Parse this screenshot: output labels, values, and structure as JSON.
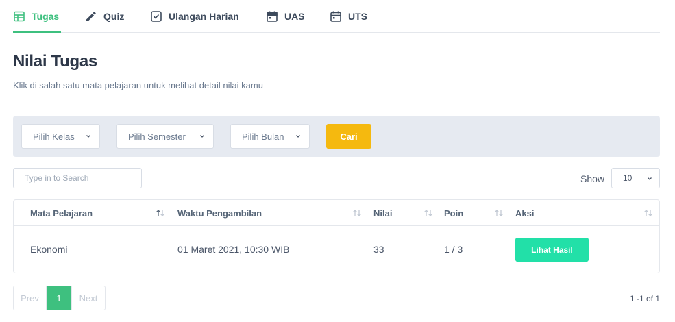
{
  "tabs": [
    {
      "label": "Tugas",
      "icon": "table-icon",
      "active": true
    },
    {
      "label": "Quiz",
      "icon": "pencil-icon",
      "active": false
    },
    {
      "label": "Ulangan Harian",
      "icon": "check-square-icon",
      "active": false
    },
    {
      "label": "UAS",
      "icon": "calendar-icon",
      "active": false
    },
    {
      "label": "UTS",
      "icon": "calendar-icon",
      "active": false
    }
  ],
  "page": {
    "title": "Nilai Tugas",
    "subtitle": "Klik di salah satu mata pelajaran untuk melihat detail nilai kamu"
  },
  "filters": {
    "kelas": "Pilih Kelas",
    "semester": "Pilih Semester",
    "bulan": "Pilih Bulan",
    "search_button": "Cari"
  },
  "search": {
    "placeholder": "Type in to Search"
  },
  "show": {
    "label": "Show",
    "value": "10"
  },
  "table": {
    "columns": [
      "Mata Pelajaran",
      "Waktu Pengambilan",
      "Nilai",
      "Poin",
      "Aksi"
    ],
    "rows": [
      {
        "mata_pelajaran": "Ekonomi",
        "waktu": "01 Maret 2021, 10:30 WIB",
        "nilai": "33",
        "poin": "1 / 3",
        "aksi": "Lihat Hasil"
      }
    ]
  },
  "pagination": {
    "prev": "Prev",
    "current": "1",
    "next": "Next",
    "range": "1 -1 of 1"
  },
  "colors": {
    "accent_green": "#3ec07f",
    "button_yellow": "#f5b90f",
    "button_teal": "#22e0a8",
    "filter_bg": "#e6eaf1"
  }
}
